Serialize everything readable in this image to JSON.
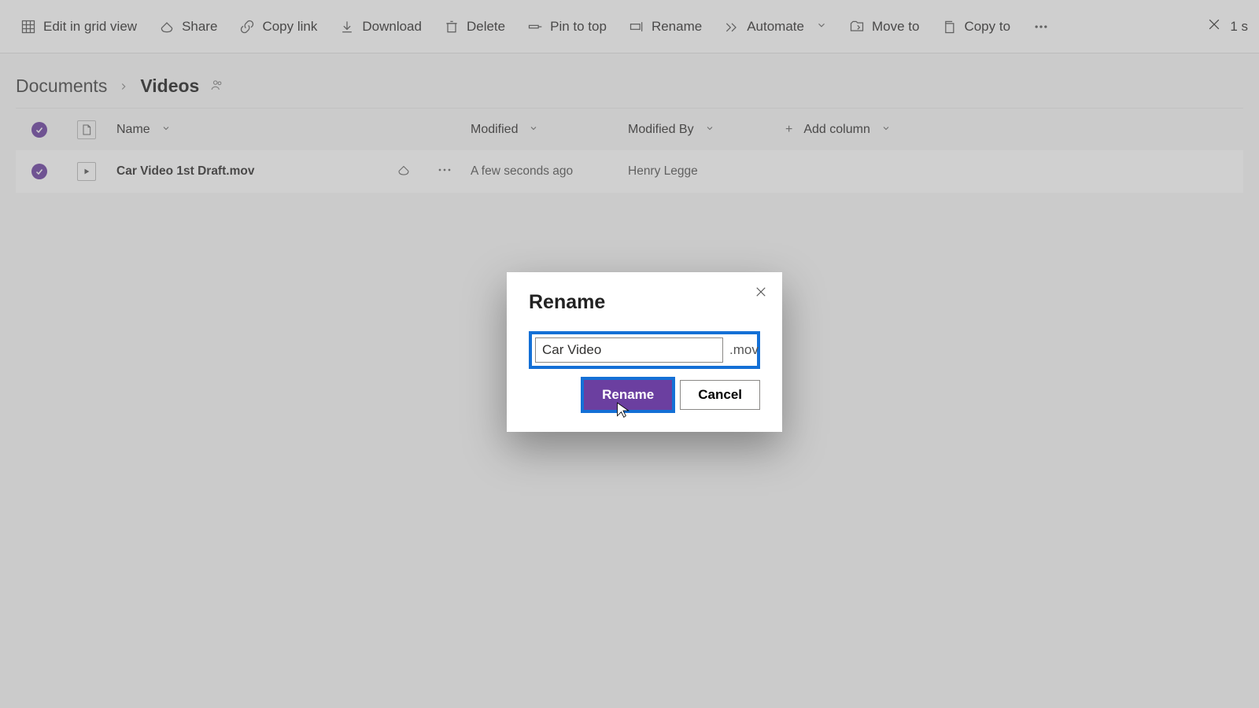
{
  "toolbar": {
    "edit_grid": "Edit in grid view",
    "share": "Share",
    "copy_link": "Copy link",
    "download": "Download",
    "delete": "Delete",
    "pin_top": "Pin to top",
    "rename": "Rename",
    "automate": "Automate",
    "move_to": "Move to",
    "copy_to": "Copy to",
    "selection": "1 s"
  },
  "breadcrumb": {
    "root": "Documents",
    "current": "Videos"
  },
  "columns": {
    "name": "Name",
    "modified": "Modified",
    "modified_by": "Modified By",
    "add_column": "Add column"
  },
  "rows": [
    {
      "name": "Car Video 1st Draft.mov",
      "modified": "A few seconds ago",
      "modified_by": "Henry Legge"
    }
  ],
  "dialog": {
    "title": "Rename",
    "value": "Car Video",
    "extension": ".mov",
    "confirm": "Rename",
    "cancel": "Cancel"
  }
}
